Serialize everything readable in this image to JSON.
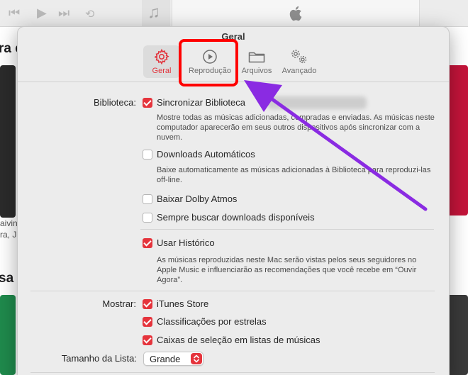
{
  "window": {
    "title": "Geral"
  },
  "tabs": [
    {
      "label": "Geral",
      "icon": "gear-icon",
      "active": true
    },
    {
      "label": "Reprodução",
      "icon": "play-circle-icon",
      "active": false
    },
    {
      "label": "Arquivos",
      "icon": "folder-icon",
      "active": false
    },
    {
      "label": "Avançado",
      "icon": "gears-icon",
      "active": false
    }
  ],
  "library": {
    "label": "Biblioteca:",
    "sync": {
      "label": "Sincronizar Biblioteca",
      "checked": true,
      "desc": "Mostre todas as músicas adicionadas, compradas e enviadas. As músicas neste computador aparecerão em seus outros dispositivos após sincronizar com a nuvem."
    },
    "auto_downloads": {
      "label": "Downloads Automáticos",
      "checked": false,
      "desc": "Baixe automaticamente as músicas adicionadas à Biblioteca para reproduzi-las off-line."
    },
    "dolby": {
      "label": "Baixar Dolby Atmos",
      "checked": false
    },
    "always_check": {
      "label": "Sempre buscar downloads disponíveis",
      "checked": false
    }
  },
  "history": {
    "label": "Usar Histórico",
    "checked": true,
    "desc": "As músicas reproduzidas neste Mac serão vistas pelos seus seguidores no Apple Music e influenciarão as recomendações que você recebe em “Ouvir Agora”."
  },
  "show": {
    "label": "Mostrar:",
    "items": [
      {
        "label": "iTunes Store",
        "checked": true
      },
      {
        "label": "Classificações por estrelas",
        "checked": true
      },
      {
        "label": "Caixas de seleção em listas de músicas",
        "checked": true
      }
    ]
  },
  "list_size": {
    "label": "Tamanho da Lista:",
    "value": "Grande"
  },
  "background": {
    "heading_top": "ra e",
    "heading_bottom": "sa s",
    "tile_caption_1": "aivin",
    "tile_caption_2": "ra, J"
  },
  "colors": {
    "accent": "#e5343c",
    "annotation_box": "#ff0000",
    "annotation_arrow": "#8a2be2"
  }
}
